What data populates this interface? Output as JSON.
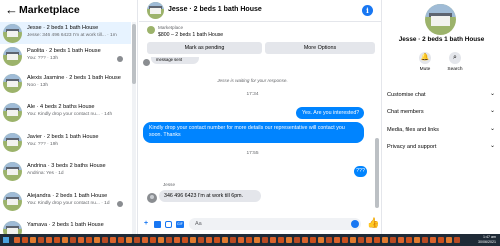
{
  "left": {
    "title": "Marketplace",
    "conversations": [
      {
        "title": "Jesse · 2 beds 1 bath House",
        "subtitle": "Jesse: 346 496 6423 I'm at work till... · 1m",
        "active": true
      },
      {
        "title": "Paolita · 2 beds 1 bath House",
        "subtitle": "You: ??? · 13h"
      },
      {
        "title": "Alexis Jasmine · 2 beds 1 bath House",
        "subtitle": "Noo · 13h"
      },
      {
        "title": "Ale · 4 beds 2 baths House",
        "subtitle": "You: Kindly drop your contact nu... · 14h"
      },
      {
        "title": "Javier · 2 beds 1 bath House",
        "subtitle": "You: ??? · 19h"
      },
      {
        "title": "Andrina · 3 beds 2 baths House",
        "subtitle": "Andrina: Yes · 1d"
      },
      {
        "title": "Alejandra · 2 beds 1 bath House",
        "subtitle": "You: Kindly drop your contact nu... · 1d"
      },
      {
        "title": "Yamava · 2 beds 1 bath House",
        "subtitle": ""
      }
    ]
  },
  "chat": {
    "title": "Jesse · 2 beds 1 bath House",
    "marketplace_label": "Marketplace",
    "listing_price": "$800 – 2 beds 1 bath House",
    "mark_pending": "Mark as pending",
    "more_options": "More Options",
    "partial_message": "message sent",
    "waiting_text": "Jesse is waiting for your response.",
    "timestamp1": "17:34",
    "outgoing1": "Yes. Are you interested?",
    "outgoing2": "Kindly drop your contact number for more details our representative will contact you soon. Thanks",
    "timestamp2": "17:55",
    "outgoing3": "???",
    "sender_name": "Jesse",
    "incoming1": "346 496 6423 I'm at work till 6pm.",
    "composer_placeholder": "Aa"
  },
  "right": {
    "title": "Jesse · 2 beds 1 bath House",
    "mute_label": "Mute",
    "search_label": "Search",
    "items": [
      "Customise chat",
      "Chat members",
      "Media, files and links",
      "Privacy and support"
    ]
  },
  "taskbar": {
    "time": "1:47 am",
    "date": "30/06/2021"
  },
  "colors": {
    "accent": "#1877f2",
    "bubble_out": "#0084ff",
    "bubble_in": "#e4e6eb",
    "active_row": "#e7f3ff"
  },
  "icons": [
    "back-arrow-icon",
    "info-icon",
    "plus-icon",
    "image-icon",
    "sticker-icon",
    "gif-icon",
    "emoji-icon",
    "like-icon",
    "bell-icon",
    "search-icon",
    "chevron-down-icon"
  ]
}
